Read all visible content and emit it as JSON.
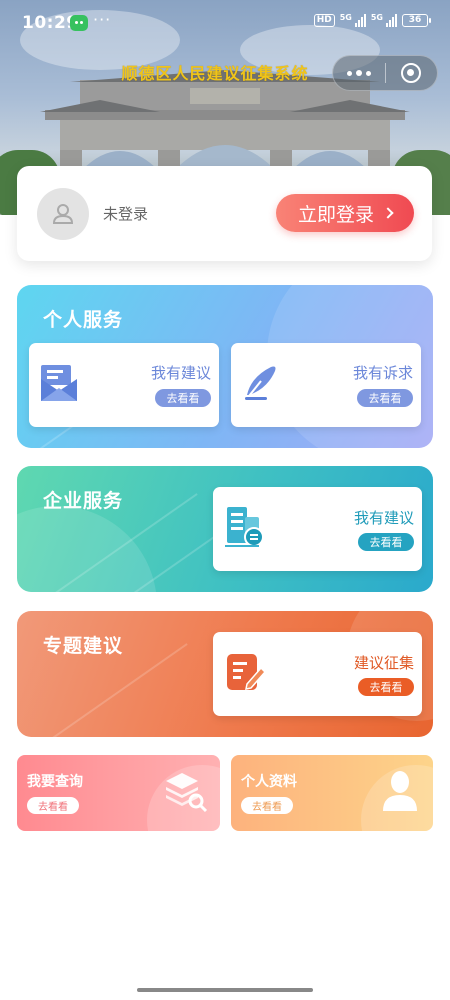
{
  "status_bar": {
    "time": "10:29",
    "more": "···",
    "hd": "HD",
    "net1": "5G",
    "net2": "5G",
    "battery": "36"
  },
  "header": {
    "title": "顺德区人民建议征集系统"
  },
  "login": {
    "status": "未登录",
    "button_label": "立即登录"
  },
  "personal": {
    "title": "个人服务",
    "cards": [
      {
        "label": "我有建议",
        "action": "去看看",
        "icon": "mail-icon"
      },
      {
        "label": "我有诉求",
        "action": "去看看",
        "icon": "quill-icon"
      }
    ]
  },
  "enterprise": {
    "title": "企业服务",
    "card": {
      "label": "我有建议",
      "action": "去看看",
      "icon": "building-icon"
    }
  },
  "topic": {
    "title": "专题建议",
    "card": {
      "label": "建议征集",
      "action": "去看看",
      "icon": "edit-icon"
    }
  },
  "tiles": [
    {
      "title": "我要查询",
      "action": "去看看",
      "icon": "layers-search-icon"
    },
    {
      "title": "个人资料",
      "action": "去看看",
      "icon": "person-icon"
    }
  ],
  "colors": {
    "title_gold": "#f0c419",
    "login_red": "#f04a52",
    "personal_blue": "#7f98e0",
    "enterprise_teal": "#25a3c1",
    "topic_orange": "#ea5d26"
  }
}
